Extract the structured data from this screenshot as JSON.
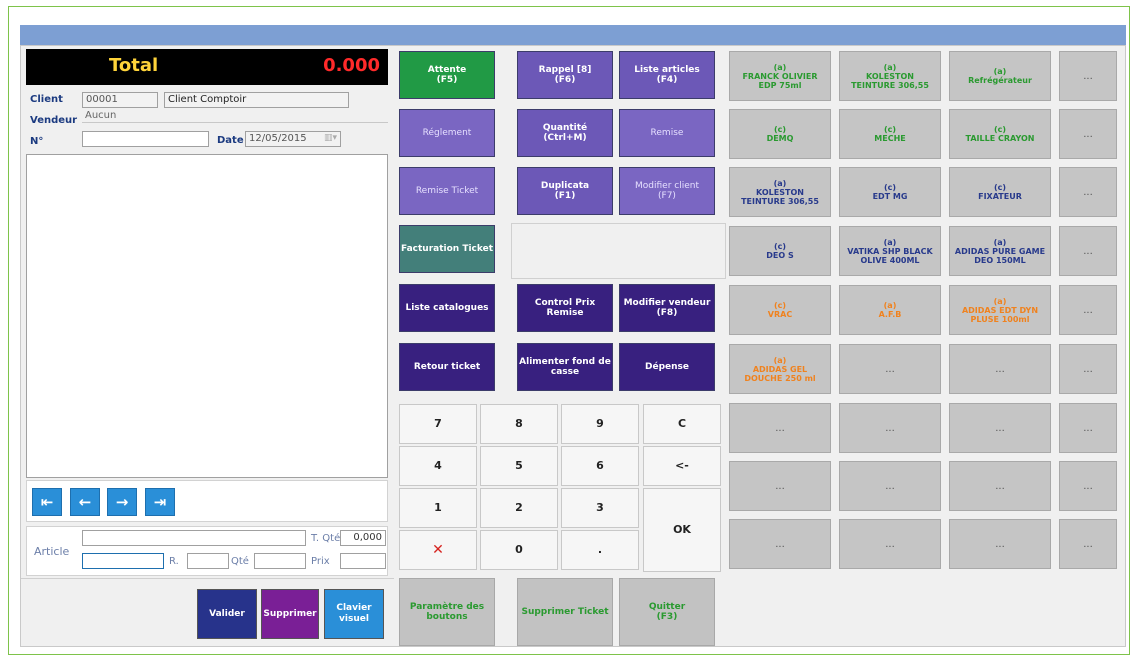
{
  "header": {
    "total_label": "Total",
    "total_value": "0.000"
  },
  "client": {
    "client_label": "Client",
    "client_code": "00001",
    "client_name": "Client Comptoir",
    "vendeur_label": "Vendeur",
    "vendeur_value": "Aucun",
    "num_label": "N°",
    "num_value": "",
    "date_label": "Date",
    "date_value": "12/05/2015"
  },
  "navigation": {
    "first": "⇤",
    "prev": "←",
    "next": "→",
    "last": "⇥"
  },
  "article": {
    "article_label": "Article",
    "tqte_label": "T. Qté",
    "tqte_value": "0,000",
    "r_label": "R.",
    "qte_label": "Qté",
    "prix_label": "Prix"
  },
  "actions": {
    "valider": "Valider",
    "supprimer": "Supprimer",
    "clavier": "Clavier\nvisuel"
  },
  "functions": {
    "attente": "Attente\n(F5)",
    "rappel": "Rappel [8]\n(F6)",
    "liste_articles": "Liste articles\n(F4)",
    "reglement": "Réglement",
    "quantite": "Quantité\n(Ctrl+M)",
    "remise": "Remise",
    "remise_ticket": "Remise Ticket",
    "duplicata": "Duplicata\n(F1)",
    "modifier_client": "Modifier client\n(F7)",
    "facturation_ticket": "Facturation Ticket",
    "liste_catalogues": "Liste catalogues",
    "control_prix_remise": "Control Prix Remise",
    "modifier_vendeur": "Modifier vendeur\n(F8)",
    "retour_ticket": "Retour ticket",
    "alimenter_fond": "Alimenter fond de\ncasse",
    "depense": "Dépense"
  },
  "keypad": {
    "k7": "7",
    "k8": "8",
    "k9": "9",
    "clear": "C",
    "k4": "4",
    "k5": "5",
    "k6": "6",
    "back": "<-",
    "k1": "1",
    "k2": "2",
    "k3": "3",
    "ok": "OK",
    "cancel": "✕",
    "k0": "0",
    "dot": "."
  },
  "products": {
    "r1": [
      "(a)\nFRANCK OLIVIER\nEDP 75ml",
      "(a)\nKOLESTON\nTEINTURE 306,55",
      "(a)\nRefrégérateur",
      "..."
    ],
    "r2": [
      "(c)\nDEMQ",
      "(c)\nMECHE",
      "(c)\nTAILLE CRAYON",
      "..."
    ],
    "r3": [
      "(a)\nKOLESTON\nTEINTURE 306,55",
      "(c)\nEDT MG",
      "(c)\nFIXATEUR",
      "..."
    ],
    "r4": [
      "(c)\nDEO S",
      "(a)\nVATIKA SHP BLACK\nOLIVE 400ML",
      "(a)\nADIDAS PURE GAME\nDEO 150ML",
      "..."
    ],
    "r5": [
      "(c)\nVRAC",
      "(a)\nA.F.B",
      "(a)\nADIDAS EDT DYN\nPLUSE 100ml",
      "..."
    ],
    "r6": [
      "(a)\nADIDAS GEL\nDOUCHE  250 ml",
      "...",
      "...",
      "..."
    ],
    "r7": [
      "...",
      "...",
      "...",
      "..."
    ],
    "r8": [
      "...",
      "...",
      "...",
      "..."
    ],
    "r9": [
      "...",
      "...",
      "...",
      "..."
    ]
  },
  "bottom": {
    "parametre": "Paramètre des\nboutons",
    "supprimer_ticket": "Supprimer Ticket",
    "quitter": "Quitter\n(F3)"
  },
  "colors": {
    "title_bar": "#7d9fd3",
    "total_label": "#ffd43a",
    "total_value": "#ff2a2a",
    "product_green": "#2a9a30",
    "product_navy": "#283a8c",
    "product_orange": "#f0821e"
  }
}
